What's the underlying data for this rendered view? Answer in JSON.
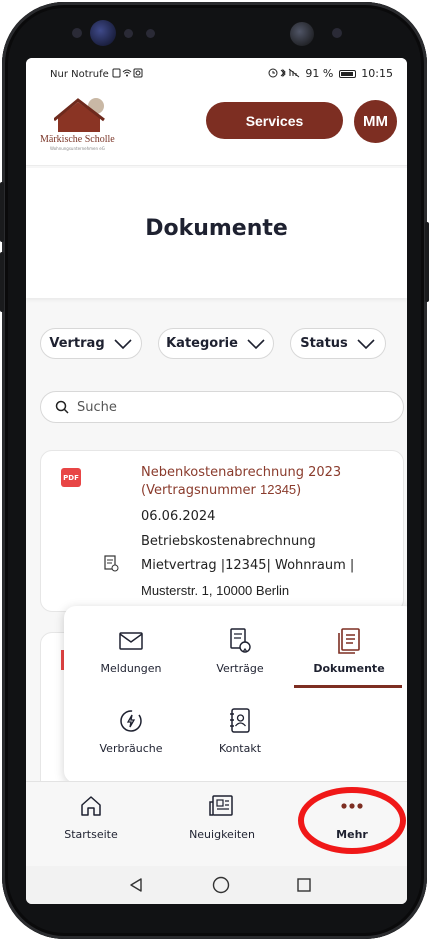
{
  "status_bar": {
    "carrier": "Nur Notrufe",
    "battery_percent": "91 %",
    "time": "10:15"
  },
  "header": {
    "brand_name": "Märkische Scholle",
    "brand_tagline": "Wohnungsunternehmen eG",
    "services_label": "Services",
    "avatar_initials": "MM"
  },
  "page": {
    "title": "Dokumente"
  },
  "filters": [
    {
      "label": "Vertrag"
    },
    {
      "label": "Kategorie"
    },
    {
      "label": "Status"
    }
  ],
  "search": {
    "placeholder": "Suche"
  },
  "documents": [
    {
      "file_type": "PDF",
      "title": "Nebenkostenabrechnung 2023",
      "contract_prefix": "(Vertragsnummer ",
      "contract_number": "12345",
      "contract_suffix": ")",
      "date": "06.06.2024",
      "category": "Betriebskostenabrechnung",
      "contract_line": "Mietvertrag |12345| Wohnraum |",
      "address": "Musterstr. 1, 10000 Berlin"
    }
  ],
  "more_menu": {
    "items": [
      {
        "label": "Meldungen",
        "icon": "mail-icon"
      },
      {
        "label": "Verträge",
        "icon": "contract-icon"
      },
      {
        "label": "Dokumente",
        "icon": "document-icon",
        "active": true
      },
      {
        "label": "Verbräuche",
        "icon": "energy-icon"
      },
      {
        "label": "Kontakt",
        "icon": "contact-book-icon"
      }
    ]
  },
  "bottom_nav": {
    "items": [
      {
        "label": "Startseite",
        "icon": "home-icon"
      },
      {
        "label": "Neuigkeiten",
        "icon": "newspaper-icon"
      },
      {
        "label": "Mehr",
        "icon": "more-dots-icon",
        "active": true
      }
    ]
  },
  "colors": {
    "brand": "#7d2e22",
    "pdf_red": "#e84545",
    "highlight_ring": "#f01818"
  }
}
